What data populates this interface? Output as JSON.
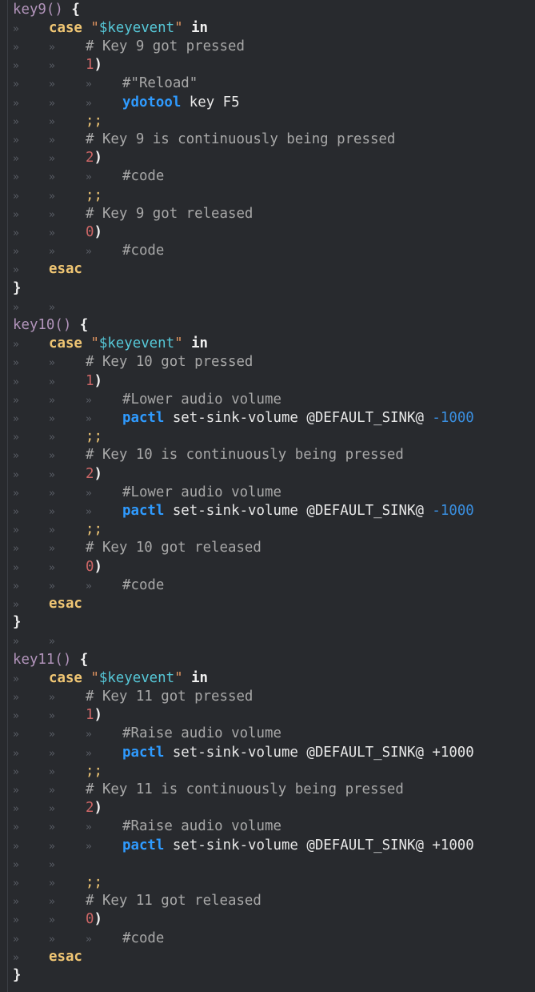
{
  "editor": {
    "whitespace_glyph": "»",
    "lines": [
      {
        "indent": 0,
        "tokens": [
          {
            "t": "key9",
            "c": "func"
          },
          {
            "t": "()",
            "c": "func"
          },
          {
            "t": " ",
            "c": "plain"
          },
          {
            "t": "{",
            "c": "brace"
          }
        ]
      },
      {
        "indent": 1,
        "tokens": [
          {
            "t": "case",
            "c": "kw"
          },
          {
            "t": " ",
            "c": "plain"
          },
          {
            "t": "\"",
            "c": "str"
          },
          {
            "t": "$keyevent",
            "c": "var"
          },
          {
            "t": "\"",
            "c": "str"
          },
          {
            "t": " ",
            "c": "plain"
          },
          {
            "t": "in",
            "c": "brace"
          }
        ]
      },
      {
        "indent": 2,
        "tokens": [
          {
            "t": "# Key 9 got pressed",
            "c": "comment"
          }
        ]
      },
      {
        "indent": 2,
        "tokens": [
          {
            "t": "1",
            "c": "num"
          },
          {
            "t": ")",
            "c": "paren"
          }
        ]
      },
      {
        "indent": 3,
        "tokens": [
          {
            "t": "#\"Reload\"",
            "c": "comment"
          }
        ]
      },
      {
        "indent": 3,
        "tokens": [
          {
            "t": "ydotool",
            "c": "cmd"
          },
          {
            "t": " key F5",
            "c": "arg"
          }
        ]
      },
      {
        "indent": 2,
        "tokens": [
          {
            "t": ";;",
            "c": "semi"
          }
        ]
      },
      {
        "indent": 2,
        "tokens": [
          {
            "t": "# Key 9 is continuously being pressed",
            "c": "comment"
          }
        ]
      },
      {
        "indent": 2,
        "tokens": [
          {
            "t": "2",
            "c": "num"
          },
          {
            "t": ")",
            "c": "paren"
          }
        ]
      },
      {
        "indent": 3,
        "tokens": [
          {
            "t": "#code",
            "c": "comment"
          }
        ]
      },
      {
        "indent": 2,
        "tokens": [
          {
            "t": ";;",
            "c": "semi"
          }
        ]
      },
      {
        "indent": 2,
        "tokens": [
          {
            "t": "# Key 9 got released",
            "c": "comment"
          }
        ]
      },
      {
        "indent": 2,
        "tokens": [
          {
            "t": "0",
            "c": "num"
          },
          {
            "t": ")",
            "c": "paren"
          }
        ]
      },
      {
        "indent": 3,
        "tokens": [
          {
            "t": "#code",
            "c": "comment"
          }
        ]
      },
      {
        "indent": 1,
        "tokens": [
          {
            "t": "esac",
            "c": "kw"
          }
        ]
      },
      {
        "indent": 0,
        "tokens": [
          {
            "t": "}",
            "c": "brace"
          }
        ]
      },
      {
        "indent": -1,
        "tokens": []
      },
      {
        "indent": 0,
        "tokens": [
          {
            "t": "key10",
            "c": "func"
          },
          {
            "t": "()",
            "c": "func"
          },
          {
            "t": " ",
            "c": "plain"
          },
          {
            "t": "{",
            "c": "brace"
          }
        ]
      },
      {
        "indent": 1,
        "tokens": [
          {
            "t": "case",
            "c": "kw"
          },
          {
            "t": " ",
            "c": "plain"
          },
          {
            "t": "\"",
            "c": "str"
          },
          {
            "t": "$keyevent",
            "c": "var"
          },
          {
            "t": "\"",
            "c": "str"
          },
          {
            "t": " ",
            "c": "plain"
          },
          {
            "t": "in",
            "c": "brace"
          }
        ]
      },
      {
        "indent": 2,
        "tokens": [
          {
            "t": "# Key 10 got pressed",
            "c": "comment"
          }
        ]
      },
      {
        "indent": 2,
        "tokens": [
          {
            "t": "1",
            "c": "num"
          },
          {
            "t": ")",
            "c": "paren"
          }
        ]
      },
      {
        "indent": 3,
        "tokens": [
          {
            "t": "#Lower audio volume",
            "c": "comment"
          }
        ]
      },
      {
        "indent": 3,
        "tokens": [
          {
            "t": "pactl",
            "c": "cmd"
          },
          {
            "t": " set-sink-volume @DEFAULT_SINK@ ",
            "c": "arg"
          },
          {
            "t": "-1000",
            "c": "neg"
          }
        ]
      },
      {
        "indent": 2,
        "tokens": [
          {
            "t": ";;",
            "c": "semi"
          }
        ]
      },
      {
        "indent": 2,
        "tokens": [
          {
            "t": "# Key 10 is continuously being pressed",
            "c": "comment"
          }
        ]
      },
      {
        "indent": 2,
        "tokens": [
          {
            "t": "2",
            "c": "num"
          },
          {
            "t": ")",
            "c": "paren"
          }
        ]
      },
      {
        "indent": 3,
        "tokens": [
          {
            "t": "#Lower audio volume",
            "c": "comment"
          }
        ]
      },
      {
        "indent": 3,
        "tokens": [
          {
            "t": "pactl",
            "c": "cmd"
          },
          {
            "t": " set-sink-volume @DEFAULT_SINK@ ",
            "c": "arg"
          },
          {
            "t": "-1000",
            "c": "neg"
          }
        ]
      },
      {
        "indent": 2,
        "tokens": [
          {
            "t": ";;",
            "c": "semi"
          }
        ]
      },
      {
        "indent": 2,
        "tokens": [
          {
            "t": "# Key 10 got released",
            "c": "comment"
          }
        ]
      },
      {
        "indent": 2,
        "tokens": [
          {
            "t": "0",
            "c": "num"
          },
          {
            "t": ")",
            "c": "paren"
          }
        ]
      },
      {
        "indent": 3,
        "tokens": [
          {
            "t": "#code",
            "c": "comment"
          }
        ]
      },
      {
        "indent": 1,
        "tokens": [
          {
            "t": "esac",
            "c": "kw"
          }
        ]
      },
      {
        "indent": 0,
        "tokens": [
          {
            "t": "}",
            "c": "brace"
          }
        ]
      },
      {
        "indent": -1,
        "tokens": []
      },
      {
        "indent": 0,
        "tokens": [
          {
            "t": "key11",
            "c": "func"
          },
          {
            "t": "()",
            "c": "func"
          },
          {
            "t": " ",
            "c": "plain"
          },
          {
            "t": "{",
            "c": "brace"
          }
        ]
      },
      {
        "indent": 1,
        "tokens": [
          {
            "t": "case",
            "c": "kw"
          },
          {
            "t": " ",
            "c": "plain"
          },
          {
            "t": "\"",
            "c": "str"
          },
          {
            "t": "$keyevent",
            "c": "var"
          },
          {
            "t": "\"",
            "c": "str"
          },
          {
            "t": " ",
            "c": "plain"
          },
          {
            "t": "in",
            "c": "brace"
          }
        ]
      },
      {
        "indent": 2,
        "tokens": [
          {
            "t": "# Key 11 got pressed",
            "c": "comment"
          }
        ]
      },
      {
        "indent": 2,
        "tokens": [
          {
            "t": "1",
            "c": "num"
          },
          {
            "t": ")",
            "c": "paren"
          }
        ]
      },
      {
        "indent": 3,
        "tokens": [
          {
            "t": "#Raise audio volume",
            "c": "comment"
          }
        ]
      },
      {
        "indent": 3,
        "tokens": [
          {
            "t": "pactl",
            "c": "cmd"
          },
          {
            "t": " set-sink-volume @DEFAULT_SINK@ +1000",
            "c": "arg"
          }
        ]
      },
      {
        "indent": 2,
        "tokens": [
          {
            "t": ";;",
            "c": "semi"
          }
        ]
      },
      {
        "indent": 2,
        "tokens": [
          {
            "t": "# Key 11 is continuously being pressed",
            "c": "comment"
          }
        ]
      },
      {
        "indent": 2,
        "tokens": [
          {
            "t": "2",
            "c": "num"
          },
          {
            "t": ")",
            "c": "paren"
          }
        ]
      },
      {
        "indent": 3,
        "tokens": [
          {
            "t": "#Raise audio volume",
            "c": "comment"
          }
        ]
      },
      {
        "indent": 3,
        "tokens": [
          {
            "t": "pactl",
            "c": "cmd"
          },
          {
            "t": " set-sink-volume @DEFAULT_SINK@ +1000",
            "c": "arg"
          }
        ]
      },
      {
        "indent": -1,
        "tokens": []
      },
      {
        "indent": 2,
        "tokens": [
          {
            "t": ";;",
            "c": "semi"
          }
        ]
      },
      {
        "indent": 2,
        "tokens": [
          {
            "t": "# Key 11 got released",
            "c": "comment"
          }
        ]
      },
      {
        "indent": 2,
        "tokens": [
          {
            "t": "0",
            "c": "num"
          },
          {
            "t": ")",
            "c": "paren"
          }
        ]
      },
      {
        "indent": 3,
        "tokens": [
          {
            "t": "#code",
            "c": "comment"
          }
        ]
      },
      {
        "indent": 1,
        "tokens": [
          {
            "t": "esac",
            "c": "kw"
          }
        ]
      },
      {
        "indent": 0,
        "tokens": [
          {
            "t": "}",
            "c": "brace"
          }
        ]
      }
    ]
  }
}
